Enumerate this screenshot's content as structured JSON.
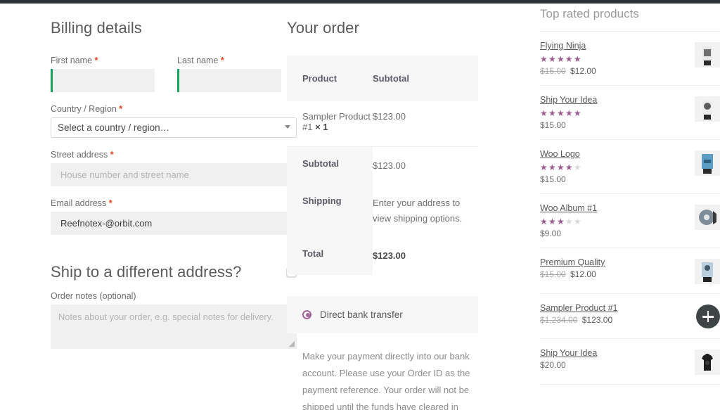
{
  "billing": {
    "title": "Billing details",
    "first_name": {
      "label": "First name",
      "required": "*",
      "value": ""
    },
    "last_name": {
      "label": "Last name",
      "required": "*",
      "value": ""
    },
    "country": {
      "label": "Country / Region",
      "required": "*",
      "value": "Select a country / region…"
    },
    "street": {
      "label": "Street address",
      "required": "*",
      "value": "",
      "placeholder": "House number and street name"
    },
    "email": {
      "label": "Email address",
      "required": "*",
      "value": "Reefnotex-@orbit.com"
    },
    "ship_different": {
      "label": "Ship to a different address?",
      "checked": false
    },
    "order_notes": {
      "label": "Order notes (optional)",
      "value": "",
      "placeholder": "Notes about your order, e.g. special notes for delivery."
    }
  },
  "order": {
    "title": "Your order",
    "columns": {
      "product": "Product",
      "subtotal": "Subtotal"
    },
    "items": [
      {
        "name": "Sampler Product #1",
        "qty": "× 1",
        "subtotal": "$123.00"
      }
    ],
    "totals": [
      {
        "label": "Subtotal",
        "value": "$123.00"
      },
      {
        "label": "Shipping",
        "value": "Enter your address to view shipping options."
      },
      {
        "label": "Total",
        "value": "$123.00"
      }
    ]
  },
  "payment": {
    "method_label": "Direct bank transfer",
    "description": "Make your payment directly into our bank account. Please use your Order ID as the payment reference. Your order will not be shipped until the funds have cleared in"
  },
  "sidebar": {
    "title": "Top rated products",
    "products": [
      {
        "name": "Flying Ninja",
        "rating": 5,
        "has_rating": true,
        "old_price": "$15.00",
        "price": "$12.00",
        "thumb": "tshirt-ninja",
        "icon": "product-thumb"
      },
      {
        "name": "Ship Your Idea",
        "rating": 5,
        "has_rating": true,
        "old_price": "",
        "price": "$15.00",
        "thumb": "tshirt-ship",
        "icon": "product-thumb"
      },
      {
        "name": "Woo Logo",
        "rating": 4,
        "has_rating": true,
        "old_price": "",
        "price": "$15.00",
        "thumb": "woo-logo-blue",
        "icon": "product-thumb"
      },
      {
        "name": "Woo Album #1",
        "rating": 3,
        "has_rating": true,
        "old_price": "",
        "price": "$9.00",
        "thumb": "album-disc",
        "icon": "product-thumb"
      },
      {
        "name": "Premium Quality",
        "rating": 0,
        "has_rating": false,
        "old_price": "$15.00",
        "price": "$12.00",
        "thumb": "tshirt-premium",
        "icon": "product-thumb"
      },
      {
        "name": "Sampler Product #1",
        "rating": 0,
        "has_rating": false,
        "old_price": "$1,234.00",
        "price": "$123.00",
        "thumb": "plus-circle",
        "icon": "plus-circle-icon"
      },
      {
        "name": "Ship Your Idea",
        "rating": 0,
        "has_rating": false,
        "old_price": "",
        "price": "$20.00",
        "thumb": "tshirt-black",
        "icon": "product-thumb"
      }
    ]
  },
  "colors": {
    "topbar": "#2c3338",
    "valid_border": "#1aa260",
    "required": "#e2401c",
    "star": "#9b5c8f",
    "radio": "#a46497",
    "field_bg": "#f0f0f0",
    "panel_bg": "#f7f7f7"
  }
}
